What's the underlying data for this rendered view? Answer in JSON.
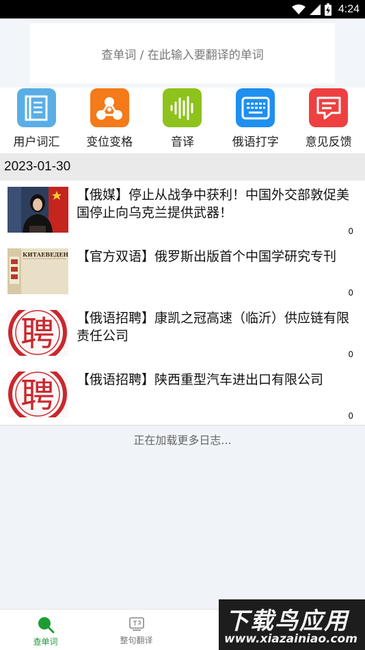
{
  "status_bar": {
    "time": "4:24",
    "icons": [
      "wifi-icon",
      "signal-icon",
      "battery-icon"
    ]
  },
  "search": {
    "placeholder": "查单词 / 在此输入要翻译的单词"
  },
  "quick_nav": [
    {
      "label": "用户词汇",
      "icon": "book-icon",
      "color": "#5aaee6"
    },
    {
      "label": "变位变格",
      "icon": "share-nodes-icon",
      "color": "#f47a1a"
    },
    {
      "label": "音译",
      "icon": "sound-wave-icon",
      "color": "#8ec21c"
    },
    {
      "label": "俄语打字",
      "icon": "keyboard-icon",
      "color": "#1f8ff0"
    },
    {
      "label": "意见反馈",
      "icon": "feedback-icon",
      "color": "#ee4040"
    }
  ],
  "date": "2023-01-30",
  "news": [
    {
      "title": "【俄媒】停止从战争中获利！中国外交部敦促美国停止向乌克兰提供武器！",
      "count": "0",
      "thumb": "press-photo"
    },
    {
      "title": "【官方双语】俄罗斯出版首个中国学研究专刊",
      "count": "0",
      "thumb": "book-cover",
      "thumb_text": "КИТАЕВЕДЕНИЕ"
    },
    {
      "title": "【俄语招聘】康凯之冠高速（临沂）供应链有限责任公司",
      "count": "0",
      "thumb": "hiring-stamp",
      "thumb_text": "聘"
    },
    {
      "title": "【俄语招聘】陕西重型汽车进出口有限公司",
      "count": "0",
      "thumb": "hiring-stamp",
      "thumb_text": "聘"
    }
  ],
  "load_more": "正在加载更多日志...",
  "tabs": [
    {
      "label": "查单词",
      "icon": "search-icon",
      "active": true
    },
    {
      "label": "整句翻译",
      "icon": "translate-icon",
      "active": false
    }
  ],
  "watermark": {
    "line1": "下载鸟应用",
    "line2": "www.xiazainiao.com"
  },
  "colors": {
    "accent": "#1e9c34",
    "date_bg": "#eaeaea",
    "page_bg": "#f0f4f8"
  }
}
